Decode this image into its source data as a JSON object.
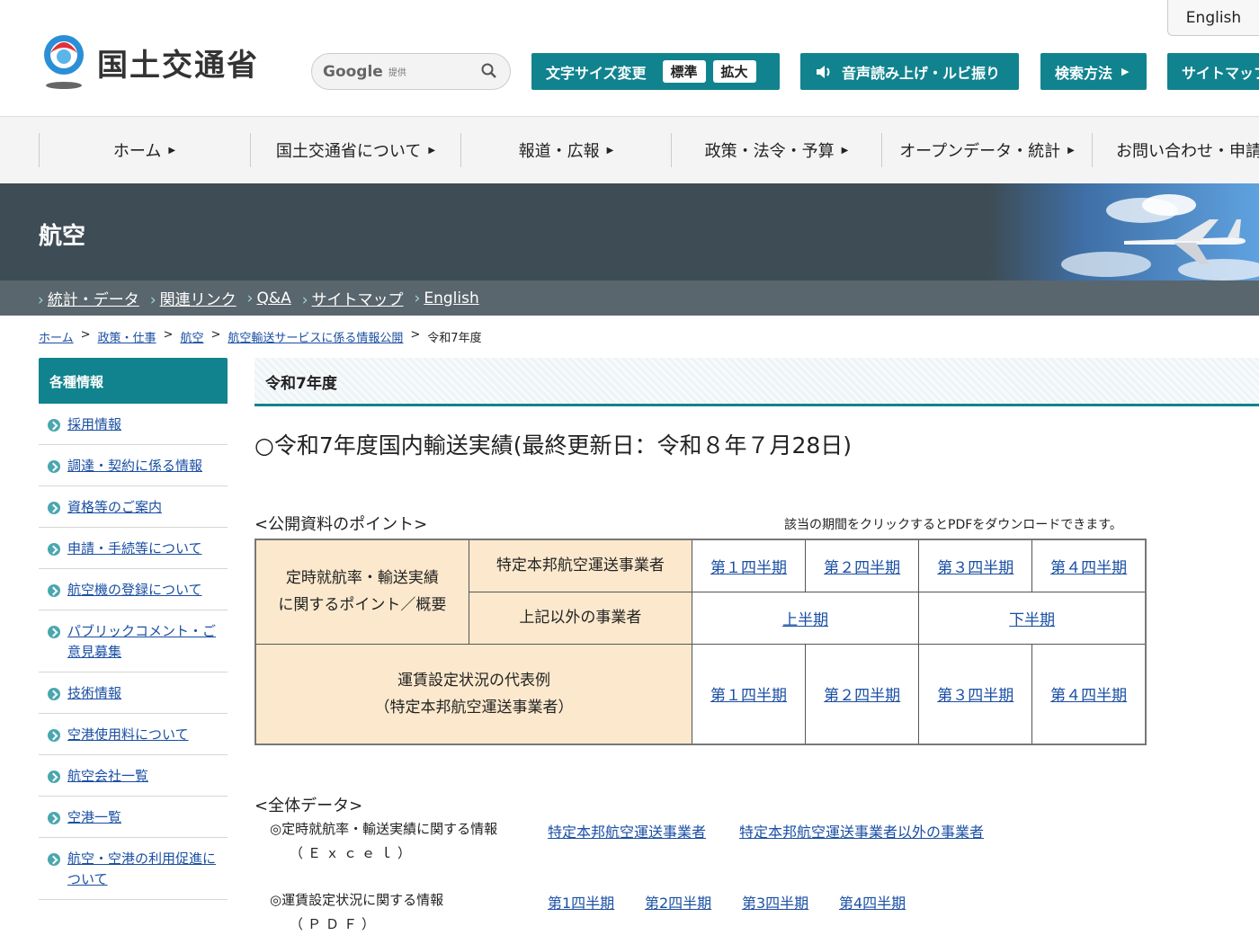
{
  "header": {
    "logo_text": "国土交通省",
    "english_tab": "English",
    "search": {
      "brand": "Google",
      "provider": "提供"
    },
    "font_size": {
      "label": "文字サイズ変更",
      "normal": "標準",
      "large": "拡大"
    },
    "voice_button": "音声読み上げ・ルビ振り",
    "search_method_button": "検索方法",
    "sitemap_button": "サイトマップ"
  },
  "global_nav": [
    "ホーム",
    "国土交通省について",
    "報道・広報",
    "政策・法令・予算",
    "オープンデータ・統計",
    "お問い合わせ・申請"
  ],
  "banner": {
    "title": "航空",
    "subnav": [
      "統計・データ",
      "関連リンク",
      "Q&A",
      "サイトマップ",
      "English"
    ]
  },
  "breadcrumb": [
    "ホーム",
    "政策・仕事",
    "航空",
    "航空輸送サービスに係る情報公開",
    "令和7年度"
  ],
  "sidebar": {
    "heading": "各種情報",
    "items": [
      "採用情報",
      "調達・契約に係る情報",
      "資格等のご案内",
      "申請・手続等について",
      "航空機の登録について",
      "パブリックコメント・ご意見募集",
      "技術情報",
      "空港使用料について",
      "航空会社一覧",
      "空港一覧",
      "航空・空港の利用促進について"
    ]
  },
  "main": {
    "section_title": "令和7年度",
    "heading": "○令和7年度国内輸送実績(最終更新日：令和８年７月28日)",
    "points_label": "<公開資料のポイント>",
    "points_note": "該当の期間をクリックするとPDFをダウンロードできます。",
    "table": {
      "row1_category": "定時就航率・輸送実績に関するポイント／概要",
      "row1_cat_line1": "定時就航率・輸送実績",
      "row1_cat_line2": "に関するポイント／概要",
      "carrier_specific": "特定本邦航空運送事業者",
      "carrier_other": "上記以外の事業者",
      "quarters": [
        "第１四半期",
        "第２四半期",
        "第３四半期",
        "第４四半期"
      ],
      "halves": [
        "上半期",
        "下半期"
      ],
      "row3_cat_line1": "運賃設定状況の代表例",
      "row3_cat_line2": "（特定本邦航空運送事業者）"
    },
    "all_data_label": "<全体データ>",
    "all_data": {
      "row1_title": "◎定時就航率・輸送実績に関する情報",
      "row1_sub": "（Ｅｘｃｅｌ）",
      "row1_links": [
        "特定本邦航空運送事業者",
        "特定本邦航空運送事業者以外の事業者"
      ],
      "row2_title": "◎運賃設定状況に関する情報",
      "row2_sub": "（ＰＤＦ）",
      "row2_links": [
        "第1四半期",
        "第2四半期",
        "第3四半期",
        "第4四半期"
      ]
    }
  }
}
